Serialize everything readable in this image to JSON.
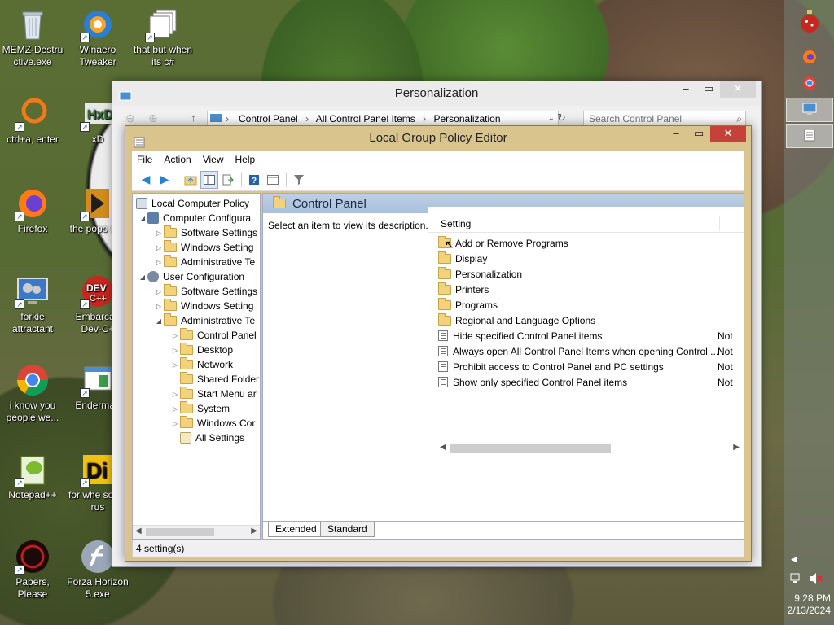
{
  "desktop_icons": [
    {
      "label": "MEMZ-Destru ctive.exe",
      "icon": "recycle-bin-icon"
    },
    {
      "label": "Winaero Tweaker",
      "icon": "winaero-icon"
    },
    {
      "label": "that but when its c#",
      "icon": "files-icon"
    },
    {
      "label": "ctrl+a, enter",
      "icon": "orange-ring-icon"
    },
    {
      "label": "xD",
      "icon": "hxd-icon"
    },
    {
      "label": "Firefox",
      "icon": "firefox-icon"
    },
    {
      "label": "the popo shit",
      "icon": "winamp-icon"
    },
    {
      "label": "forkie attractant",
      "icon": "monitor-gear-icon"
    },
    {
      "label": "Embarcad Dev-C+",
      "icon": "devcpp-icon"
    },
    {
      "label": "i know you people we...",
      "icon": "chrome-icon"
    },
    {
      "label": "Enderman",
      "icon": "app-window-icon"
    },
    {
      "label": "Notepad++",
      "icon": "notepadpp-icon"
    },
    {
      "label": "for whe some rus",
      "icon": "diesel-icon"
    },
    {
      "label": "Papers, Please",
      "icon": "papers-please-icon"
    },
    {
      "label": "Forza Horizon 5.exe",
      "icon": "flash-icon"
    }
  ],
  "personalization": {
    "title": "Personalization",
    "breadcrumb": [
      "Control Panel",
      "All Control Panel Items",
      "Personalization"
    ],
    "search_placeholder": "Search Control Panel"
  },
  "gpe": {
    "title": "Local Group Policy Editor",
    "menu": [
      "File",
      "Action",
      "View",
      "Help"
    ],
    "tree": {
      "root": "Local Computer Policy",
      "computer_config": "Computer Configura",
      "cc_software": "Software Settings",
      "cc_windows": "Windows Setting",
      "cc_admin": "Administrative Te",
      "user_config": "User Configuration",
      "uc_software": "Software Settings",
      "uc_windows": "Windows Setting",
      "uc_admin": "Administrative Te",
      "control_panel": "Control Panel",
      "desktop": "Desktop",
      "network": "Network",
      "shared_folders": "Shared Folder",
      "start_menu": "Start Menu ar",
      "system": "System",
      "windows_comp": "Windows Cor",
      "all_settings": "All Settings"
    },
    "header": "Control Panel",
    "description": "Select an item to view its description.",
    "column_setting": "Setting",
    "folders": [
      "Add or Remove Programs",
      "Display",
      "Personalization",
      "Printers",
      "Programs",
      "Regional and Language Options"
    ],
    "policies": [
      {
        "name": "Hide specified Control Panel items",
        "state": "Not"
      },
      {
        "name": "Always open All Control Panel Items when opening Control ...",
        "state": "Not"
      },
      {
        "name": "Prohibit access to Control Panel and PC settings",
        "state": "Not"
      },
      {
        "name": "Show only specified Control Panel items",
        "state": "Not"
      }
    ],
    "tabs": [
      "Extended",
      "Standard"
    ],
    "status": "4 setting(s)"
  },
  "clock": {
    "time": "9:28 PM",
    "date": "2/13/2024"
  }
}
